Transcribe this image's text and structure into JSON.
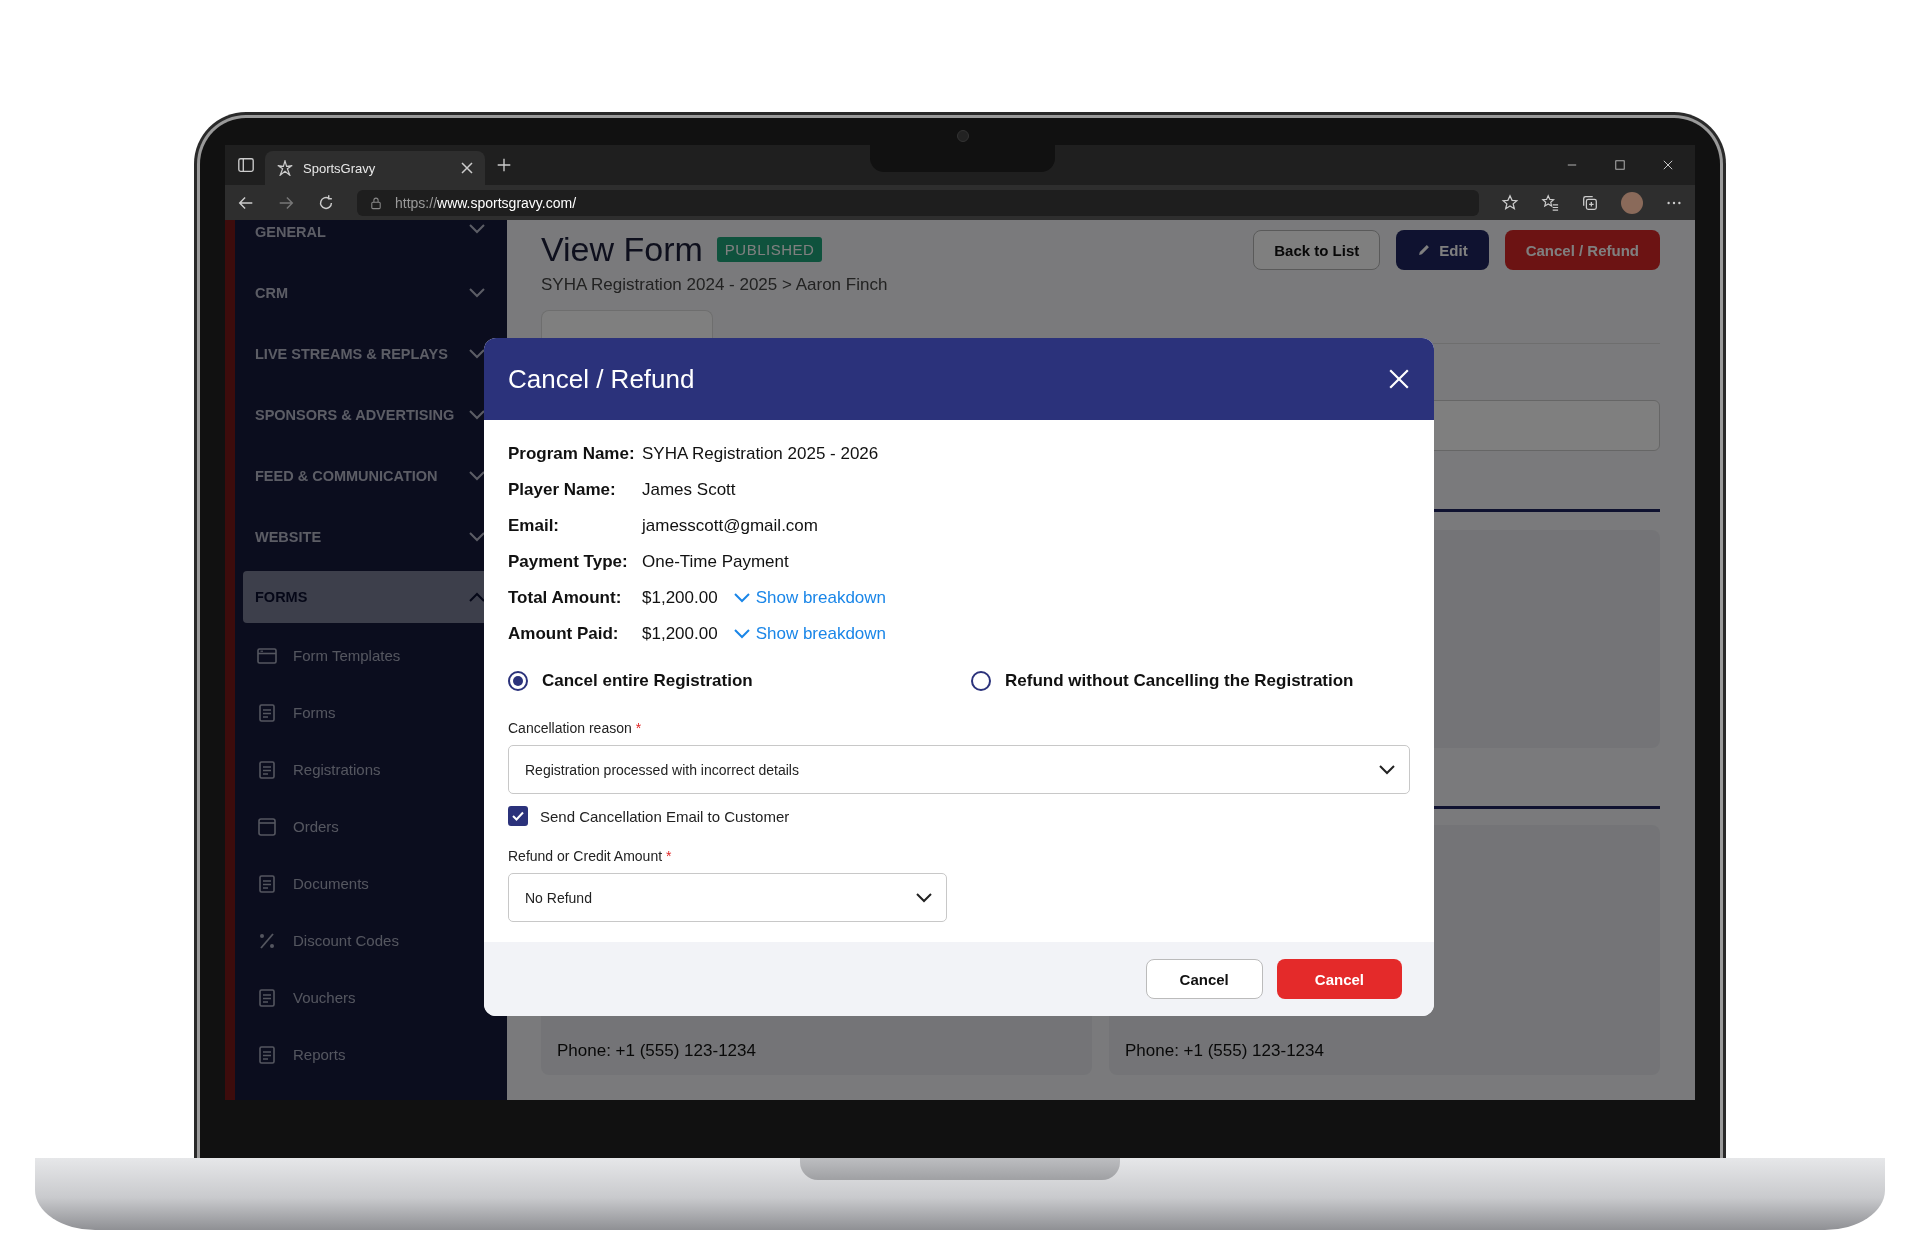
{
  "browser": {
    "tabs": [
      {
        "title": "SportsGravy",
        "selected": true
      }
    ],
    "url_scheme": "https://",
    "url_host": "www.sportsgravy.com/"
  },
  "sidebar": {
    "sections": [
      {
        "label": "GENERAL",
        "expanded": false
      },
      {
        "label": "CRM",
        "expanded": false
      },
      {
        "label": "LIVE STREAMS & REPLAYS",
        "expanded": false
      },
      {
        "label": "SPONSORS & ADVERTISING",
        "expanded": false
      },
      {
        "label": "FEED & COMMUNICATION",
        "expanded": false
      },
      {
        "label": "WEBSITE",
        "expanded": false
      },
      {
        "label": "FORMS",
        "expanded": true,
        "children": [
          {
            "label": "Form Templates",
            "kind": "window"
          },
          {
            "label": "Forms",
            "kind": "document"
          },
          {
            "label": "Registrations",
            "kind": "document"
          },
          {
            "label": "Orders",
            "kind": "box"
          },
          {
            "label": "Documents",
            "kind": "document"
          },
          {
            "label": "Discount Codes",
            "kind": "percent"
          },
          {
            "label": "Vouchers",
            "kind": "document"
          },
          {
            "label": "Reports",
            "kind": "document"
          }
        ]
      }
    ]
  },
  "page": {
    "title": "View Form",
    "status": "PUBLISHED",
    "breadcrumb": "SYHA Registration 2024 - 2025 > Aaron Finch",
    "actions": [
      {
        "label": "Back to List",
        "kind": "outline"
      },
      {
        "label": "Edit",
        "kind": "primary"
      },
      {
        "label": "Cancel / Refund",
        "kind": "danger"
      }
    ],
    "contacts": [
      "Phone:  +1 (555) 123-1234",
      "Phone:  +1 (555) 123-1234"
    ]
  },
  "modal": {
    "title": "Cancel / Refund",
    "details": [
      {
        "label": "Program Name:",
        "value": "SYHA Registration 2025 - 2026"
      },
      {
        "label": "Player Name:",
        "value": "James Scott"
      },
      {
        "label": "Email:",
        "value": "jamesscott@gmail.com"
      },
      {
        "label": "Payment Type:",
        "value": "One-Time Payment"
      },
      {
        "label": "Total Amount:",
        "value": "$1,200.00",
        "link": "Show breakdown"
      },
      {
        "label": "Amount Paid:",
        "value": "$1,200.00",
        "link": "Show breakdown"
      }
    ],
    "options": [
      {
        "label": "Cancel entire Registration",
        "selected": true
      },
      {
        "label": "Refund without Cancelling the Registration",
        "selected": false
      }
    ],
    "reason": {
      "label": "Cancellation reason",
      "required_mark": "*",
      "value": "Registration processed with incorrect details"
    },
    "send_email": {
      "label": "Send Cancellation Email to Customer",
      "checked": true
    },
    "refund": {
      "label": "Refund or Credit Amount",
      "required_mark": "*",
      "value": "No Refund"
    },
    "buttons": [
      {
        "label": "Cancel",
        "kind": "secondary"
      },
      {
        "label": "Cancel",
        "kind": "danger"
      }
    ]
  }
}
